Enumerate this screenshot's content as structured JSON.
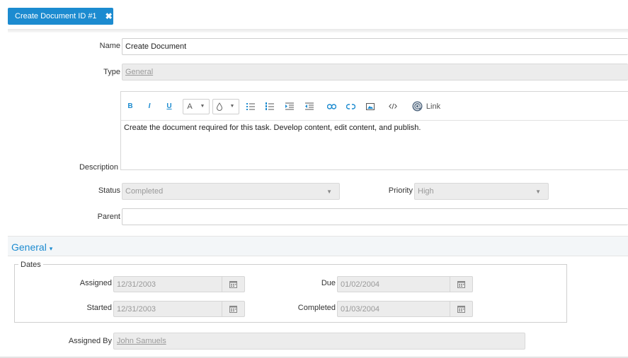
{
  "tab": {
    "label": "Create Document ID #1",
    "close_glyph": "✖"
  },
  "form": {
    "name_label": "Name",
    "name_value": "Create Document",
    "type_label": "Type",
    "type_value": "General",
    "description_label": "Description",
    "description_text": "Create the document required for this task. Develop content, edit content, and publish.",
    "status_label": "Status",
    "status_value": "Completed",
    "priority_label": "Priority",
    "priority_value": "High",
    "parent_label": "Parent",
    "parent_value": ""
  },
  "toolbar": {
    "bold": "B",
    "italic": "I",
    "underline": "U",
    "font_color": "A",
    "link_button": "Link",
    "link_icon": "at-sign-icon",
    "dropdown_glyph": "▼"
  },
  "general": {
    "title": "General",
    "caret": "▾",
    "dates_legend": "Dates",
    "assigned_label": "Assigned",
    "assigned_value": "12/31/2003",
    "due_label": "Due",
    "due_value": "01/02/2004",
    "started_label": "Started",
    "started_value": "12/31/2003",
    "completed_label": "Completed",
    "completed_value": "01/03/2004",
    "assigned_by_label": "Assigned By",
    "assigned_by_value": "John Samuels"
  },
  "colors": {
    "accent": "#1c8bd0",
    "disabled_bg": "#ececec"
  }
}
